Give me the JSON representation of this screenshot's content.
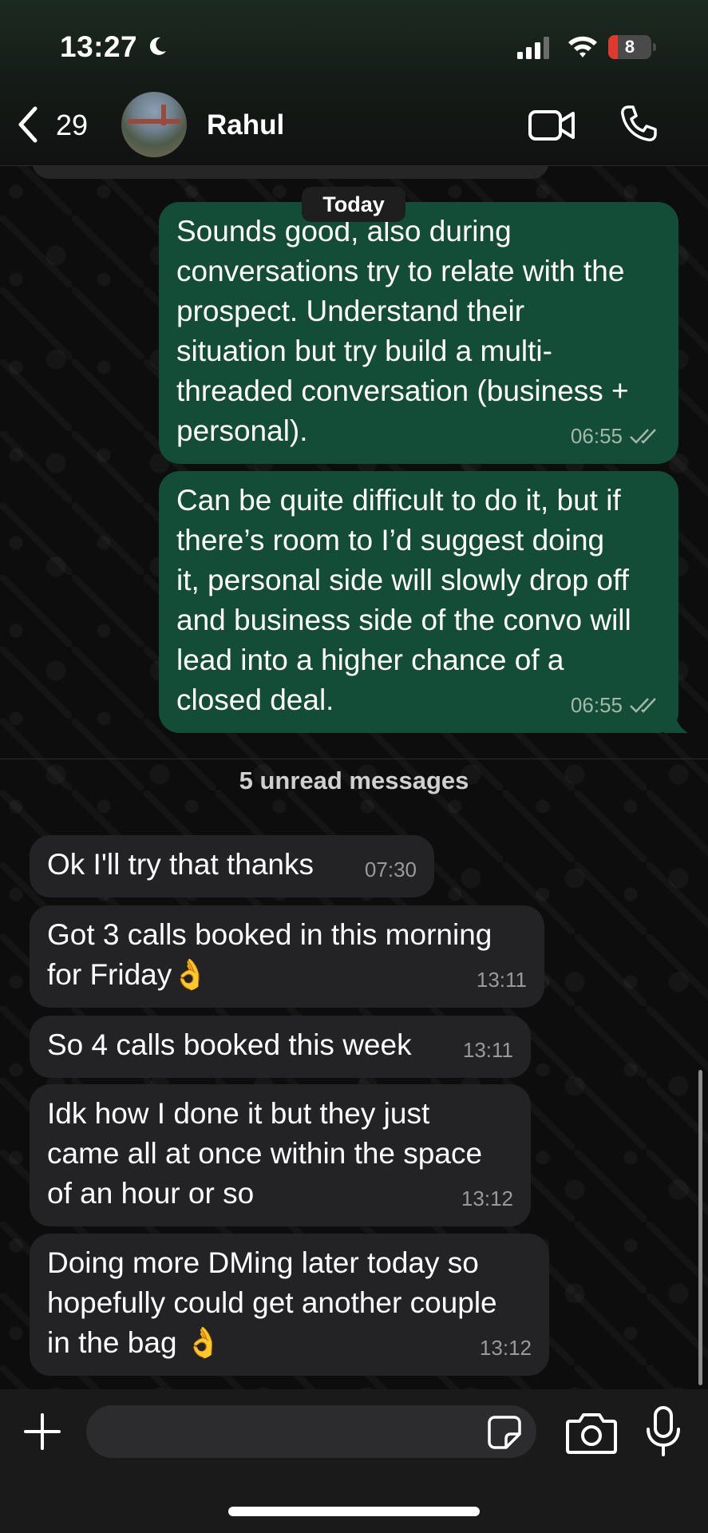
{
  "status_bar": {
    "time": "13:27",
    "battery": "8"
  },
  "header": {
    "back_count": "29",
    "contact_name": "Rahul"
  },
  "date_separator": "Today",
  "messages_out": [
    {
      "text": "Sounds good, also during\nconversations try to relate with the\nprospect. Understand their\nsituation but try build a multi-\nthreaded conversation (business +\npersonal).",
      "time": "06:55"
    },
    {
      "text": "Can be quite difficult to do it, but if\nthere’s room to I’d suggest doing\nit, personal side will slowly drop off\nand business side of the convo will\nlead into a higher chance of a\nclosed deal.",
      "time": "06:55"
    }
  ],
  "unread_label": "5 unread messages",
  "messages_in": [
    {
      "text": "Ok I'll try that thanks",
      "time": "07:30"
    },
    {
      "text": "Got 3 calls booked in this morning\nfor Friday👌",
      "time": "13:11"
    },
    {
      "text": "So 4 calls booked this week",
      "time": "13:11"
    },
    {
      "text": "Idk how I done it but they just\ncame all at once within the space\nof an hour or so",
      "time": "13:12"
    },
    {
      "text": "Doing more DMing later today so\nhopefully could get another couple\nin the bag 👌",
      "time": "13:12"
    }
  ],
  "input": {
    "placeholder": ""
  },
  "icons": {
    "moon": "moon-icon",
    "signal": "signal-icon",
    "wifi": "wifi-icon",
    "back": "chevron-left-icon",
    "video": "video-camera-icon",
    "call": "phone-icon",
    "plus": "plus-icon",
    "sticker": "sticker-icon",
    "camera": "camera-icon",
    "mic": "microphone-icon",
    "read": "double-check-icon"
  },
  "colors": {
    "outgoing_bubble": "#144d37",
    "incoming_bubble": "#232325",
    "battery_low": "#e03a2f"
  }
}
